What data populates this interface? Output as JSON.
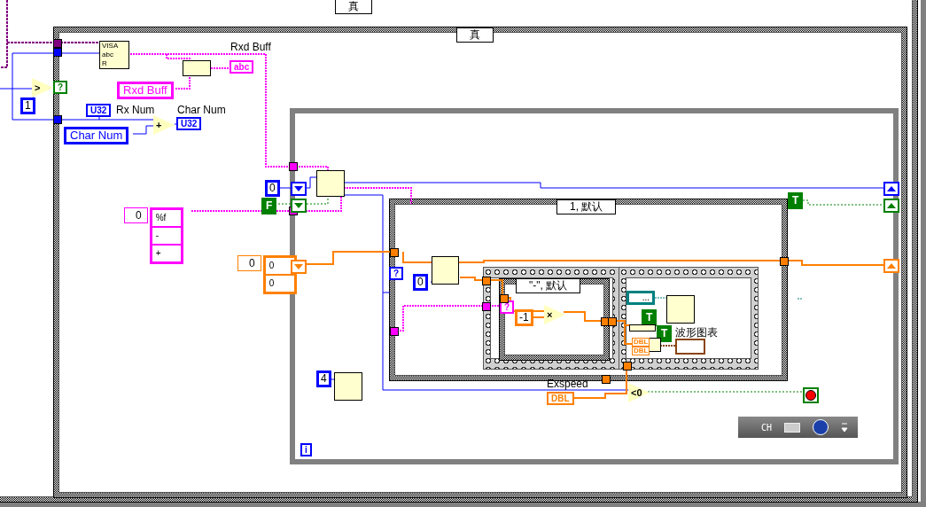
{
  "selectors": [
    {
      "label": "真"
    },
    {
      "label": "真"
    },
    {
      "label": "1, 默认"
    },
    {
      "label": "\"-\", 默认"
    }
  ],
  "labels": [
    "Rxd Buff",
    "Rx Num",
    "Char Num",
    "波形图表",
    "Exspeed"
  ],
  "constants": [
    {
      "text": "1",
      "kind": "int"
    },
    {
      "text": "0",
      "kind": "int"
    },
    {
      "text": "F",
      "kind": "bool"
    },
    {
      "text": "0",
      "kind": "int"
    },
    {
      "text": "-1",
      "kind": "double"
    },
    {
      "text": "4",
      "kind": "int"
    },
    {
      "text": "T",
      "kind": "bool"
    },
    {
      "text": "T",
      "kind": "bool"
    },
    {
      "text": "T",
      "kind": "bool"
    }
  ],
  "terminals": [
    {
      "text": "abc",
      "kind": "string"
    },
    {
      "text": "U32",
      "kind": "int"
    },
    {
      "text": "U32",
      "kind": "int"
    },
    {
      "text": "DBL",
      "kind": "double"
    },
    {
      "text": "?",
      "kind": "bool"
    },
    {
      "text": "?",
      "kind": "int"
    },
    {
      "text": "?",
      "kind": "string"
    },
    {
      "text": "i",
      "kind": "int"
    }
  ],
  "local_variables": [
    {
      "name": "Rxd Buff",
      "kind": "string"
    },
    {
      "name": "Char Num",
      "kind": "int"
    }
  ],
  "operators": [
    ">",
    "+",
    "×",
    "<0"
  ],
  "array_constants": [
    {
      "kind": "string",
      "index": "0",
      "items": [
        "%f",
        "-",
        "+"
      ]
    },
    {
      "kind": "double",
      "index": "0",
      "items": [
        "0",
        "0"
      ]
    }
  ],
  "visa_read": {
    "lines": [
      "VISA",
      "abc",
      "R"
    ]
  },
  "cluster_constant": {
    "text": "..."
  },
  "bundle_inputs": [
    "DBL",
    "DBL"
  ],
  "taskbar": {
    "language": "CH"
  }
}
